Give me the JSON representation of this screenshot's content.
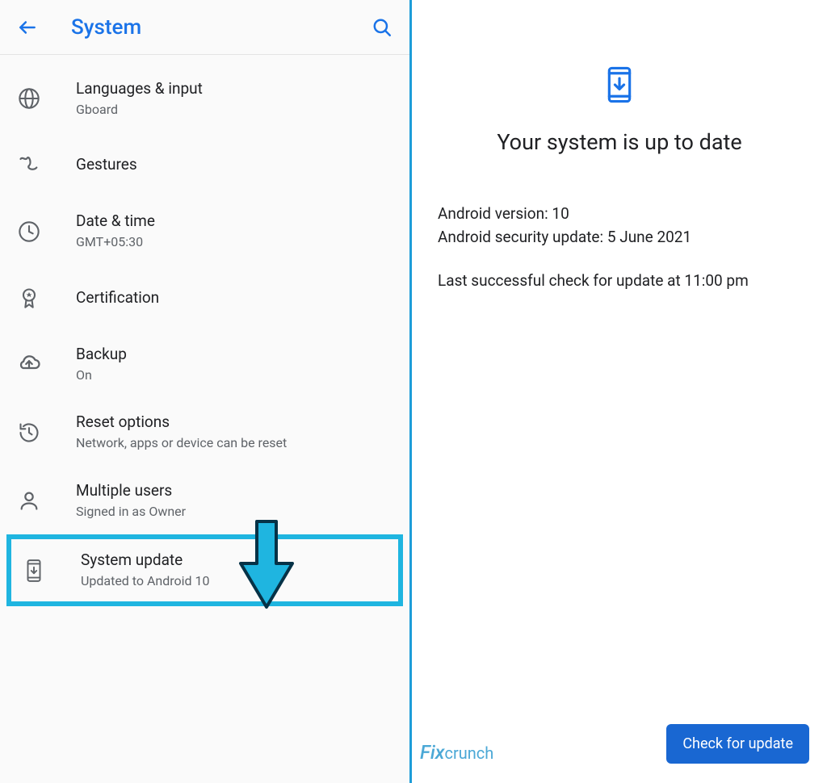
{
  "header": {
    "title": "System"
  },
  "items": {
    "lang": {
      "title": "Languages & input",
      "subtitle": "Gboard"
    },
    "gest": {
      "title": "Gestures",
      "subtitle": ""
    },
    "date": {
      "title": "Date & time",
      "subtitle": "GMT+05:30"
    },
    "cert": {
      "title": "Certification",
      "subtitle": ""
    },
    "backup": {
      "title": "Backup",
      "subtitle": "On"
    },
    "reset": {
      "title": "Reset options",
      "subtitle": "Network, apps or device can be reset"
    },
    "users": {
      "title": "Multiple users",
      "subtitle": "Signed in as Owner"
    },
    "sysupd": {
      "title": "System update",
      "subtitle": "Updated to Android 10"
    }
  },
  "update": {
    "title": "Your system is up to date",
    "version_label": "Android version: 10",
    "security_label": "Android security update: 5 June 2021",
    "last_check": "Last successful check for update at 11:00 pm",
    "button": "Check for update"
  },
  "watermark": {
    "prefix": "Fix",
    "suffix": "crunch"
  }
}
